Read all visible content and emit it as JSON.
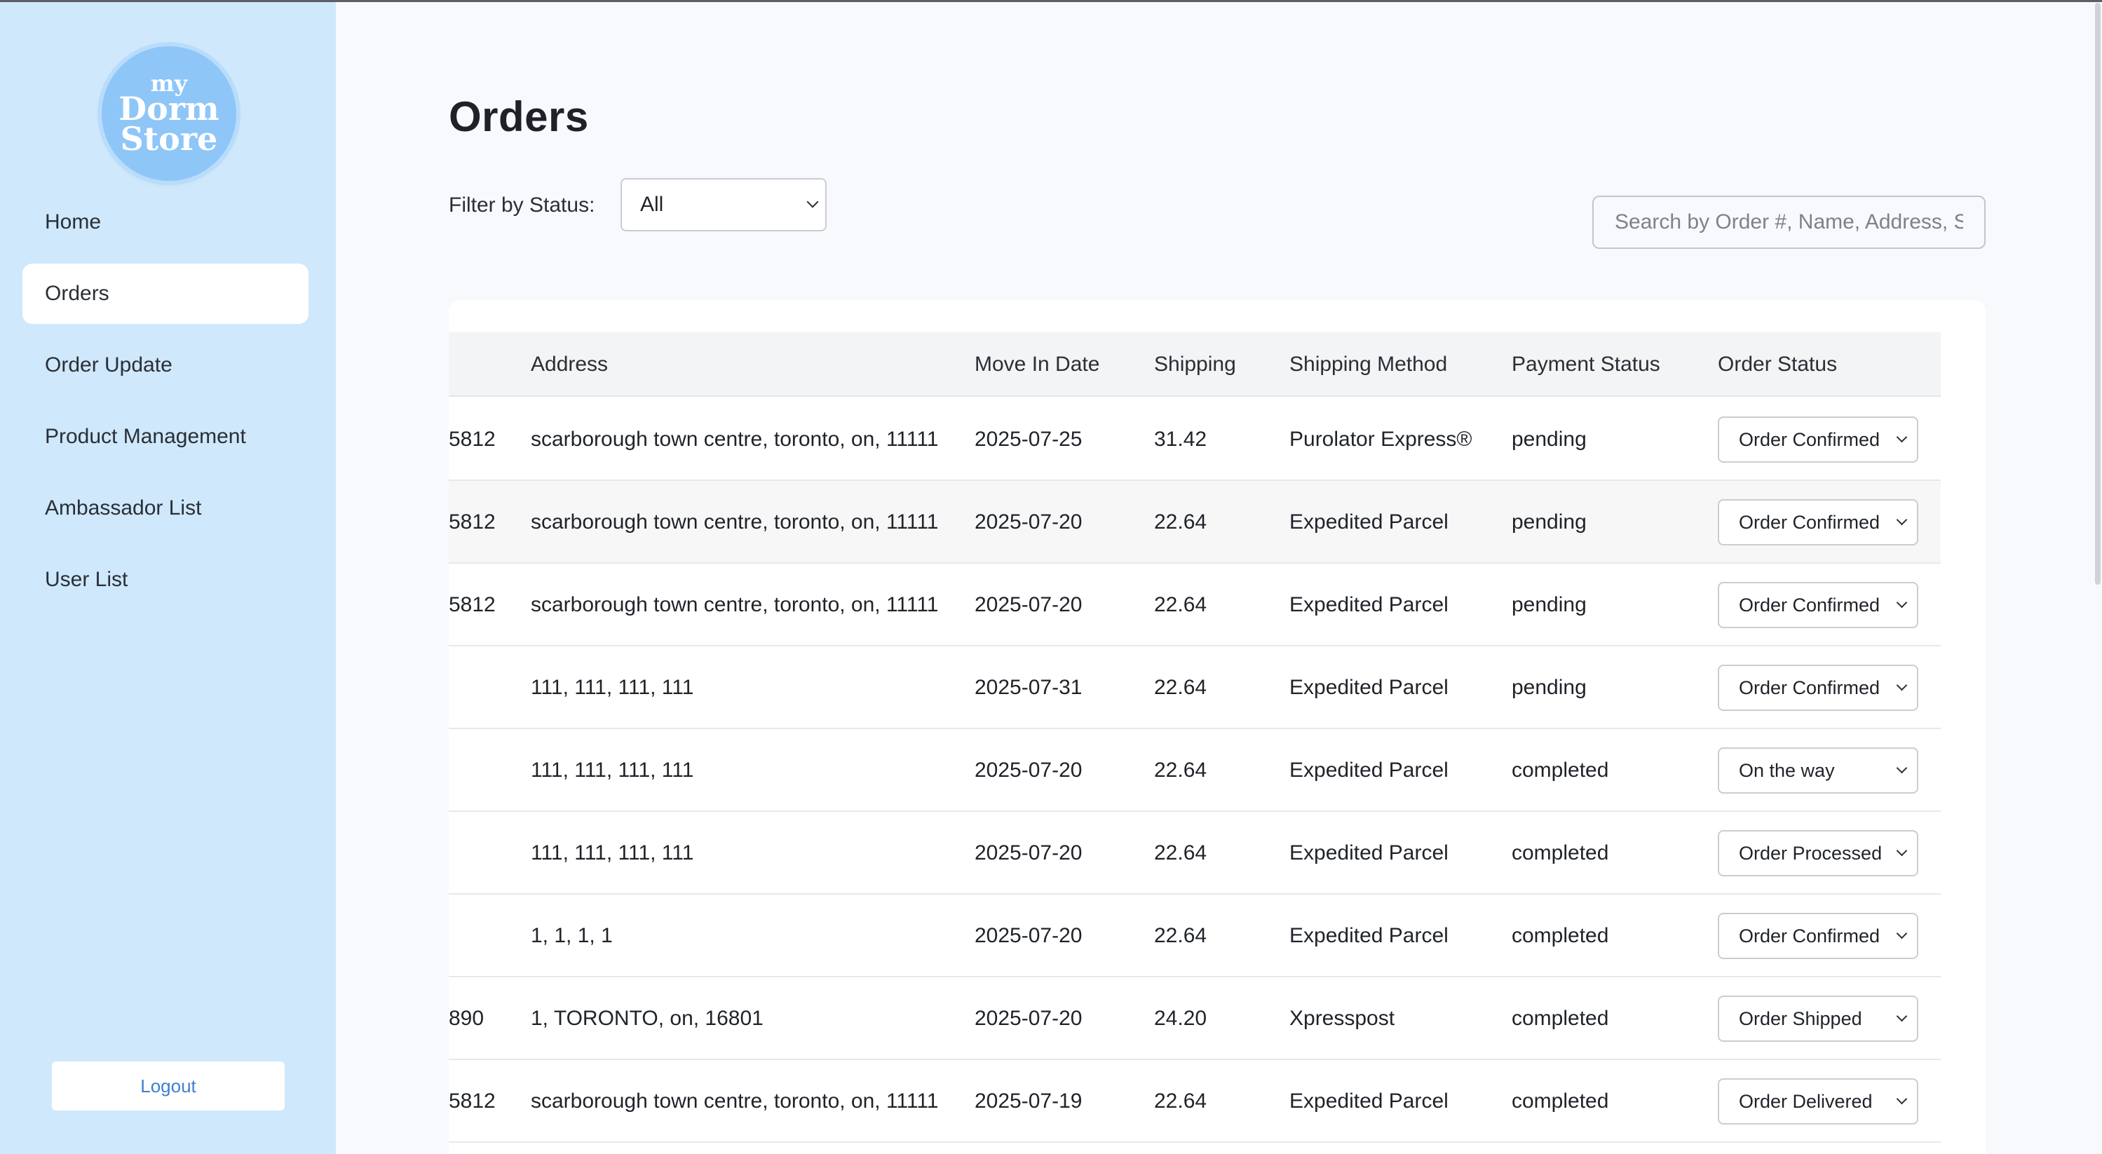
{
  "brand": {
    "logo_line1": "my",
    "logo_line2": "Dorm",
    "logo_line3": "Store"
  },
  "sidebar": {
    "items": [
      {
        "label": "Home",
        "active": false
      },
      {
        "label": "Orders",
        "active": true
      },
      {
        "label": "Order Update",
        "active": false
      },
      {
        "label": "Product Management",
        "active": false
      },
      {
        "label": "Ambassador List",
        "active": false
      },
      {
        "label": "User List",
        "active": false
      }
    ],
    "logout_label": "Logout"
  },
  "page": {
    "title": "Orders",
    "filter_label": "Filter by Status:",
    "filter_value": "All",
    "search_placeholder": "Search by Order #, Name, Address, S"
  },
  "table": {
    "headers": {
      "address": "Address",
      "move_in_date": "Move In Date",
      "shipping": "Shipping",
      "shipping_method": "Shipping Method",
      "payment_status": "Payment Status",
      "order_status": "Order Status"
    },
    "rows": [
      {
        "id_fragment": "5812",
        "address": "scarborough town centre, toronto, on, 11111",
        "move_in_date": "2025-07-25",
        "shipping": "31.42",
        "shipping_method": "Purolator Express®",
        "payment_status": "pending",
        "order_status": "Order Confirmed"
      },
      {
        "id_fragment": "5812",
        "address": "scarborough town centre, toronto, on, 11111",
        "move_in_date": "2025-07-20",
        "shipping": "22.64",
        "shipping_method": "Expedited Parcel",
        "payment_status": "pending",
        "order_status": "Order Confirmed"
      },
      {
        "id_fragment": "5812",
        "address": "scarborough town centre, toronto, on, 11111",
        "move_in_date": "2025-07-20",
        "shipping": "22.64",
        "shipping_method": "Expedited Parcel",
        "payment_status": "pending",
        "order_status": "Order Confirmed"
      },
      {
        "id_fragment": "",
        "address": "111, 111, 111, 111",
        "move_in_date": "2025-07-31",
        "shipping": "22.64",
        "shipping_method": "Expedited Parcel",
        "payment_status": "pending",
        "order_status": "Order Confirmed"
      },
      {
        "id_fragment": "",
        "address": "111, 111, 111, 111",
        "move_in_date": "2025-07-20",
        "shipping": "22.64",
        "shipping_method": "Expedited Parcel",
        "payment_status": "completed",
        "order_status": "On the way"
      },
      {
        "id_fragment": "",
        "address": "111, 111, 111, 111",
        "move_in_date": "2025-07-20",
        "shipping": "22.64",
        "shipping_method": "Expedited Parcel",
        "payment_status": "completed",
        "order_status": "Order Processed"
      },
      {
        "id_fragment": "",
        "address": "1, 1, 1, 1",
        "move_in_date": "2025-07-20",
        "shipping": "22.64",
        "shipping_method": "Expedited Parcel",
        "payment_status": "completed",
        "order_status": "Order Confirmed"
      },
      {
        "id_fragment": "890",
        "address": "1, TORONTO, on, 16801",
        "move_in_date": "2025-07-20",
        "shipping": "24.20",
        "shipping_method": "Xpresspost",
        "payment_status": "completed",
        "order_status": "Order Shipped"
      },
      {
        "id_fragment": "5812",
        "address": "scarborough town centre, toronto, on, 11111",
        "move_in_date": "2025-07-19",
        "shipping": "22.64",
        "shipping_method": "Expedited Parcel",
        "payment_status": "completed",
        "order_status": "Order Delivered"
      }
    ]
  }
}
